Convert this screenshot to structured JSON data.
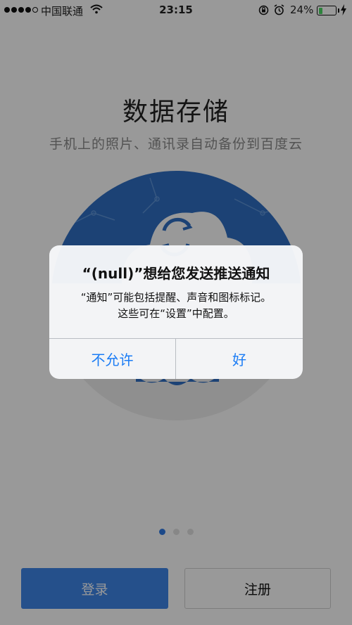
{
  "status_bar": {
    "carrier": "中国联通",
    "time": "23:15",
    "battery_percent": "24%",
    "battery_level": 0.24,
    "signal_bars": 4,
    "icons": [
      "signal-dots-icon",
      "wifi-icon",
      "rotation-lock-icon",
      "alarm-icon",
      "battery-icon",
      "charging-icon"
    ]
  },
  "onboarding": {
    "title": "数据存储",
    "subtitle": "手机上的照片、通讯录自动备份到百度云",
    "hero_icon": "cloud-sync-icon",
    "page_count": 3,
    "current_page": 1
  },
  "buttons": {
    "login": "登录",
    "register": "注册"
  },
  "alert": {
    "title": "“(null)”想给您发送推送通知",
    "message_line1": "“通知”可能包括提醒、声音和图标标记。",
    "message_line2": "这些可在“设置”中配置。",
    "deny": "不允许",
    "allow": "好"
  },
  "colors": {
    "accent": "#3f86e8",
    "alert_button": "#1a7cf5",
    "hero_blue": "#2f6fc4"
  }
}
